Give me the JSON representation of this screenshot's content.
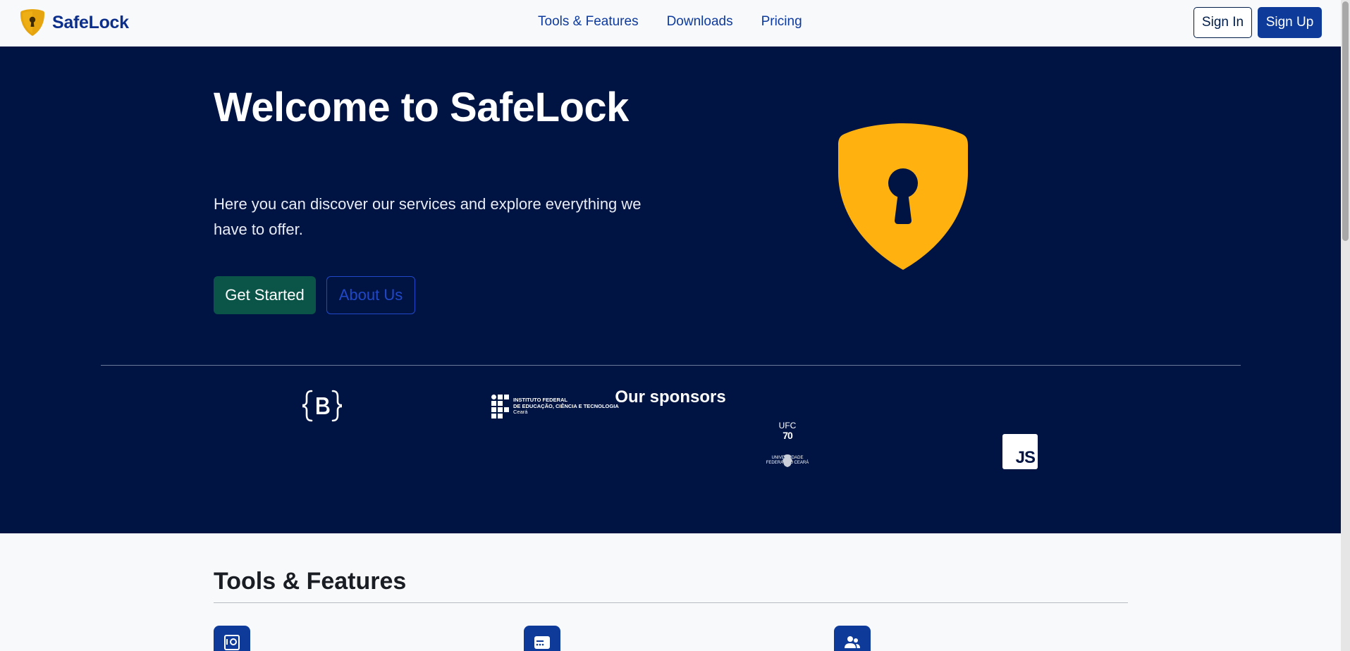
{
  "navbar": {
    "brand": "SafeLock",
    "links": [
      "Tools & Features",
      "Downloads",
      "Pricing"
    ],
    "sign_in": "Sign In",
    "sign_up": "Sign Up"
  },
  "hero": {
    "title": "Welcome to SafeLock",
    "subtitle": "Here you can discover our services and explore everything we have to offer.",
    "primary_button": "Get Started",
    "secondary_button": "About Us",
    "illustration": "shield-keyhole-icon"
  },
  "sponsors": {
    "title": "Our sponsors",
    "items": [
      {
        "name": "Bootstrap",
        "icon": "bootstrap-logo"
      },
      {
        "name": "Instituto Federal",
        "line1": "INSTITUTO FEDERAL",
        "line2": "DE EDUCAÇÃO, CIÊNCIA E TECNOLOGIA",
        "line3": "Ceará",
        "icon": "ifce-logo"
      },
      {
        "name": "UFC",
        "top": "UFC",
        "number": "70",
        "bottom1": "UNIVERSIDADE",
        "bottom2": "FEDERAL DO CEARÁ",
        "icon": "ufc-logo"
      },
      {
        "name": "JavaScript",
        "label": "JS",
        "icon": "js-logo"
      }
    ]
  },
  "features": {
    "title": "Tools & Features",
    "icons": [
      "vault-icon",
      "password-card-icon",
      "people-icon"
    ]
  },
  "colors": {
    "brand_blue": "#0e3a99",
    "hero_bg": "#001443",
    "shield_yellow": "#ffb20f",
    "primary_green": "#0a5547"
  }
}
